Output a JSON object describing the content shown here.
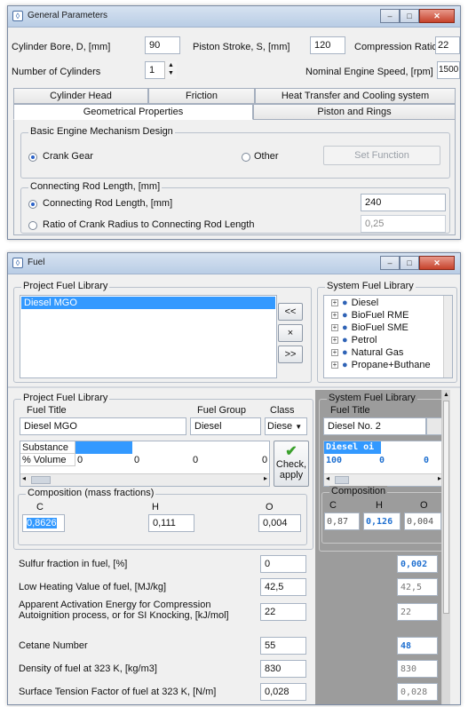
{
  "general": {
    "title": "General Parameters",
    "bore_label": "Cylinder Bore, D, [mm]",
    "bore_value": "90",
    "stroke_label": "Piston Stroke, S, [mm]",
    "stroke_value": "120",
    "cr_label": "Compression Ratio",
    "cr_value": "22",
    "ncyl_label": "Number of Cylinders",
    "ncyl_value": "1",
    "speed_label": "Nominal Engine Speed, [rpm]",
    "speed_value": "1500",
    "tabs_row1": [
      "Cylinder Head",
      "Friction",
      "Heat Transfer and Cooling system"
    ],
    "tabs_row2": [
      "Geometrical Properties",
      "Piston and Rings"
    ],
    "mech_group": "Basic Engine Mechanism Design",
    "crank_gear": "Crank Gear",
    "other": "Other",
    "set_function": "Set Function",
    "rod_group": "Connecting Rod Length, [mm]",
    "rod_option": "Connecting Rod Length, [mm]",
    "rod_value": "240",
    "ratio_option": "Ratio of Crank Radius to Connecting Rod Length",
    "ratio_value": "0,25"
  },
  "fuel": {
    "title": "Fuel",
    "project_lib": "Project Fuel Library",
    "project_items": [
      "Diesel MGO"
    ],
    "btn_left": "<<",
    "btn_x": "×",
    "btn_right": ">>",
    "system_lib": "System Fuel Library",
    "system_items": [
      "Diesel",
      "BioFuel RME",
      "BioFuel SME",
      "Petrol",
      "Natural Gas",
      "Propane+Buthane"
    ],
    "detail_project_lib": "Project Fuel Library",
    "fuel_title_label": "Fuel Title",
    "fuel_title_value": "Diesel MGO",
    "fuel_group_label": "Fuel Group",
    "fuel_group_value": "Diesel",
    "class_label": "Class",
    "class_value": "Diese",
    "substance_label": "Substance",
    "volume_label": "% Volume",
    "volume_values": [
      "0",
      "0",
      "0",
      "0"
    ],
    "check_apply": "Check, apply",
    "composition_label": "Composition (mass fractions)",
    "comp_headers": [
      "C",
      "H",
      "O"
    ],
    "comp_values": [
      "0,8626",
      "0,111",
      "0,004"
    ],
    "sys_lib_label": "System Fuel Library",
    "sys_fuel_title_label": "Fuel Title",
    "sys_fuel_title_value": "Diesel No. 2",
    "sys_substance": "Diesel oi",
    "sys_volume_values": [
      "100",
      "0",
      "0"
    ],
    "sys_comp_label": "Composition",
    "sys_comp_values": [
      "0,87",
      "0,126",
      "0,004"
    ],
    "props": [
      {
        "label": "Sulfur fraction in fuel, [%]",
        "value": "0",
        "sys": "0,002",
        "sys_bold": true
      },
      {
        "label": "Low Heating Value of fuel, [MJ/kg]",
        "value": "42,5",
        "sys": "42,5",
        "sys_bold": false
      },
      {
        "label": "Apparent Activation Energy for Compression",
        "label2": "Autoignition process, or for SI Knocking, [kJ/mol]",
        "value": "22",
        "sys": "22",
        "sys_bold": false
      },
      {
        "label": "Cetane Number",
        "value": "55",
        "sys": "48",
        "sys_bold": true
      },
      {
        "label": "Density of fuel at 323 K, [kg/m3]",
        "value": "830",
        "sys": "830",
        "sys_bold": false
      },
      {
        "label": "Surface Tension Factor of fuel at 323 K, [N/m]",
        "value": "0,028",
        "sys": "0,028",
        "sys_bold": false
      }
    ]
  },
  "colors": {
    "selection": "#3399ff",
    "accent_text": "#1e6fd0",
    "gray_panel": "#9c9c9c",
    "green_check": "#3aa02c"
  }
}
